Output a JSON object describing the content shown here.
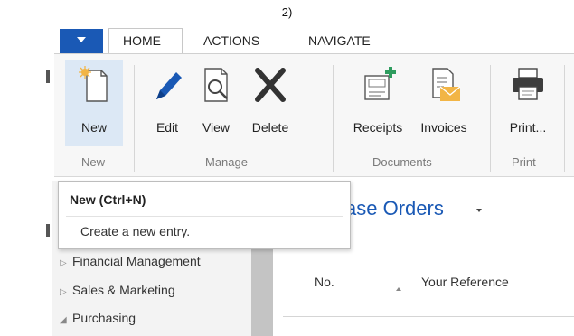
{
  "caption": "2)",
  "tabs": {
    "home": "HOME",
    "actions": "ACTIONS",
    "navigate": "NAVIGATE"
  },
  "ribbon": {
    "new": "New",
    "edit": "Edit",
    "view": "View",
    "delete": "Delete",
    "receipts": "Receipts",
    "invoices": "Invoices",
    "print": "Print...",
    "groups": {
      "new": "New",
      "manage": "Manage",
      "documents": "Documents",
      "print": "Print"
    }
  },
  "tooltip": {
    "title": "New (Ctrl+N)",
    "description": "Create a new entry."
  },
  "nav": {
    "items": [
      {
        "label": "Financial Management",
        "state": "collapsed"
      },
      {
        "label": "Sales & Marketing",
        "state": "collapsed"
      },
      {
        "label": "Purchasing",
        "state": "expanded"
      }
    ]
  },
  "content": {
    "title": "ase Orders",
    "columns": [
      "No.",
      "Your Reference"
    ]
  },
  "colors": {
    "accent": "#1a59b5",
    "ribbon_bg": "#f7f7f7",
    "selected_button": "#dce8f5",
    "nav_bg": "#f3f3f3",
    "mail_icon": "#f2b546",
    "receipt_plus": "#2e9c5e"
  }
}
